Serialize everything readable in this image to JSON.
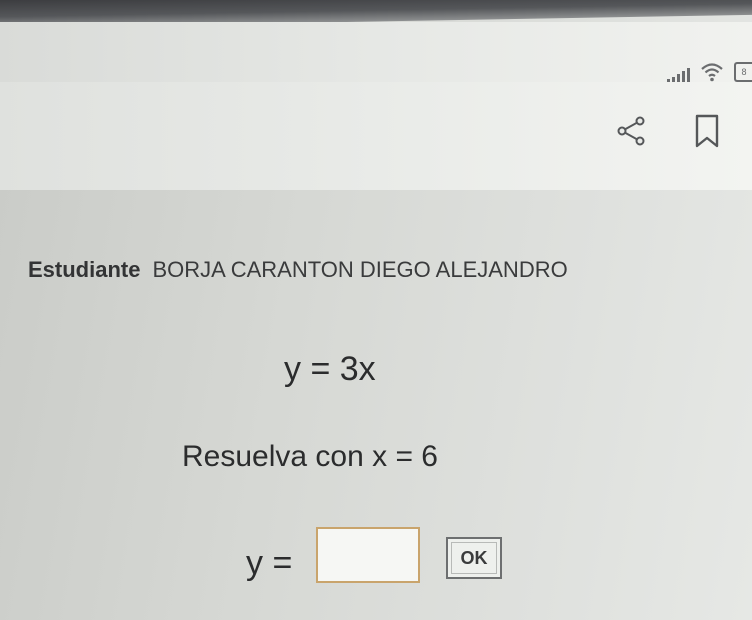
{
  "status_bar": {
    "battery_text": "8"
  },
  "toolbar": {
    "share_icon": "share-icon",
    "bookmark_icon": "bookmark-icon"
  },
  "exercise": {
    "student_label": "Estudiante",
    "student_name": "BORJA CARANTON DIEGO ALEJANDRO",
    "equation": "y = 3x",
    "instruction": "Resuelva con x = 6",
    "answer_label": "y =",
    "answer_value": "",
    "ok_label": "OK"
  },
  "colors": {
    "input_border": "#c9a46c",
    "text": "#2b2c2d"
  }
}
